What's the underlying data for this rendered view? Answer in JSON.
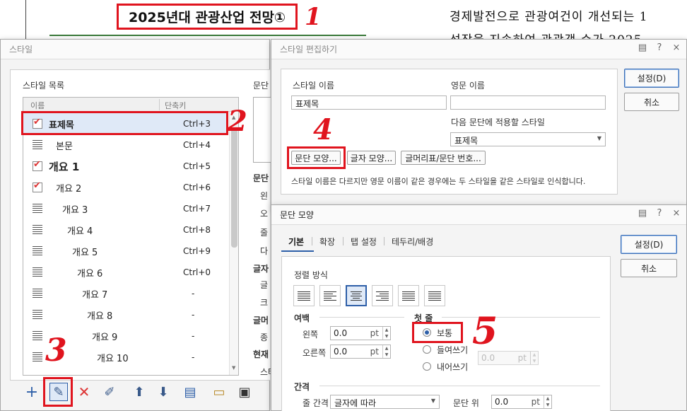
{
  "document": {
    "title": "2025년대 관광산업 전망①",
    "body_line1": "경제발전으로 관광여건이 개선되는 1",
    "body_line2": "성장을 지속하여 관광객 수가 2025",
    "annotation_1": "1"
  },
  "style_dialog": {
    "title": "스타일",
    "list_heading": "스타일 목록",
    "col_name": "이름",
    "col_shortcut": "단축키",
    "items": [
      {
        "name": "표제목",
        "shortcut": "Ctrl+3",
        "icon": "check-style-icon"
      },
      {
        "name": "본문",
        "shortcut": "Ctrl+4",
        "icon": "paragraph-style-icon"
      },
      {
        "name": "개요 1",
        "shortcut": "Ctrl+5",
        "icon": "check-style-icon"
      },
      {
        "name": "개요 2",
        "shortcut": "Ctrl+6",
        "icon": "check-style-icon"
      },
      {
        "name": "개요 3",
        "shortcut": "Ctrl+7",
        "icon": "paragraph-style-icon"
      },
      {
        "name": "개요 4",
        "shortcut": "Ctrl+8",
        "icon": "paragraph-style-icon"
      },
      {
        "name": "개요 5",
        "shortcut": "Ctrl+9",
        "icon": "paragraph-style-icon"
      },
      {
        "name": "개요 6",
        "shortcut": "Ctrl+0",
        "icon": "paragraph-style-icon"
      },
      {
        "name": "개요 7",
        "shortcut": "-",
        "icon": "paragraph-style-icon"
      },
      {
        "name": "개요 8",
        "shortcut": "-",
        "icon": "paragraph-style-icon"
      },
      {
        "name": "개요 9",
        "shortcut": "-",
        "icon": "paragraph-style-icon"
      },
      {
        "name": "개요 10",
        "shortcut": "-",
        "icon": "paragraph-style-icon"
      }
    ],
    "preview_label": "문단",
    "side_sections": [
      "문단",
      "왼",
      "오",
      "줄",
      "다",
      "글자",
      "글",
      "크",
      "글머",
      "종",
      "현재",
      "스타"
    ],
    "annotation_2": "2",
    "annotation_3": "3"
  },
  "edit_dialog": {
    "title": "스타일 편집하기",
    "style_name_label": "스타일 이름",
    "style_name_value": "표제목",
    "english_name_label": "영문 이름",
    "english_name_value": "",
    "next_style_label": "다음 문단에 적용할 스타일",
    "next_style_value": "표제목",
    "btn_paragraph": "문단 모양...",
    "btn_char": "글자 모양...",
    "btn_bullet": "글머리표/문단 번호...",
    "note": "스타일 이름은 다르지만 영문 이름이 같은 경우에는 두 스타일을 같은 스타일로 인식합니다.",
    "ok": "설정(D)",
    "cancel": "취소",
    "annotation_4": "4"
  },
  "paragraph_dialog": {
    "title": "문단 모양",
    "tabs": [
      "기본",
      "확장",
      "탭 설정",
      "테두리/배경"
    ],
    "align_label": "정렬 방식",
    "margin_label": "여백",
    "left_label": "왼쪽",
    "left_value": "0.0",
    "right_label": "오른쪽",
    "right_value": "0.0",
    "unit": "pt",
    "first_line_label": "첫 줄",
    "radio_normal": "보통",
    "radio_indent": "들여쓰기",
    "radio_outdent": "내어쓰기",
    "indent_value": "0.0",
    "spacing_label": "간격",
    "line_spacing_label": "줄 간격",
    "line_spacing_value": "글자에 따라",
    "para_above_label": "문단 위",
    "para_above_value": "0.0",
    "ok": "설정(D)",
    "cancel": "취소",
    "annotation_5": "5"
  },
  "window_icons": {
    "help": "?",
    "close": "×",
    "menu": "▤"
  }
}
